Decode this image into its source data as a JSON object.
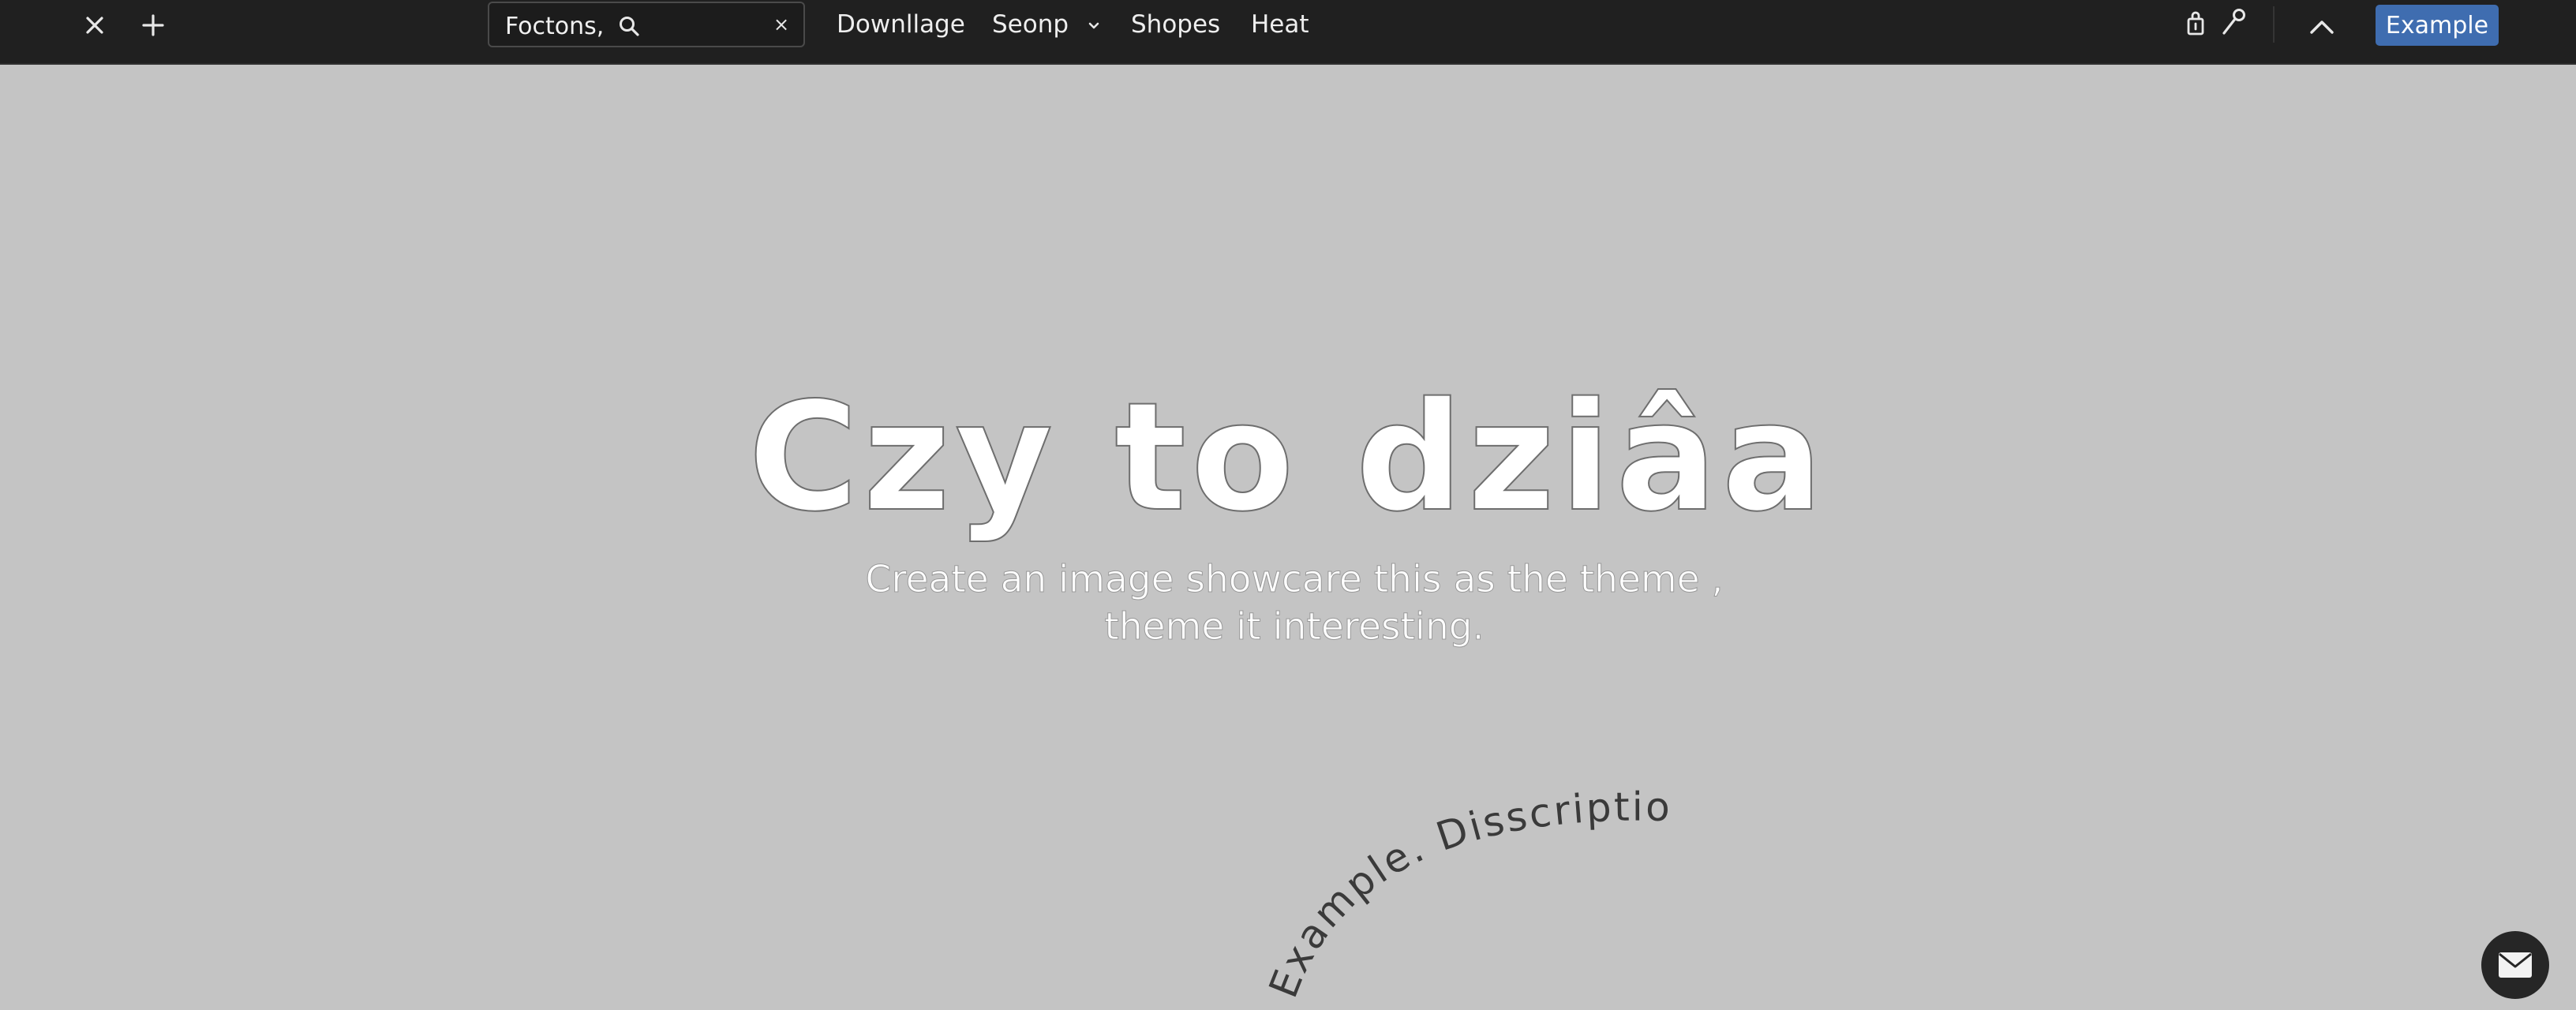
{
  "toolbar": {
    "close_icon": "close-icon",
    "add_icon": "plus-icon",
    "search": {
      "value": "Foctons,",
      "icon": "search-icon",
      "clear_label": "×"
    },
    "nav": [
      {
        "label": "Downllage"
      },
      {
        "label": "Seonp",
        "icon": "chevron-down-icon"
      },
      {
        "label": "Shopes"
      },
      {
        "label": "Heat"
      }
    ],
    "right_icons": [
      "bag-icon",
      "key-icon",
      "chevron-up-icon"
    ],
    "example_button": "Example",
    "accent_color": "#3f6db0"
  },
  "hero": {
    "title": "Czy to dziâa",
    "subtitle": "Create an image showcare this as the theme , theme it interesting.",
    "curved_text": "Example. Disscription!"
  },
  "chat_fab": {
    "icon": "mail-icon"
  },
  "colors": {
    "background": "#c4c4c4",
    "topbar": "#202020"
  }
}
